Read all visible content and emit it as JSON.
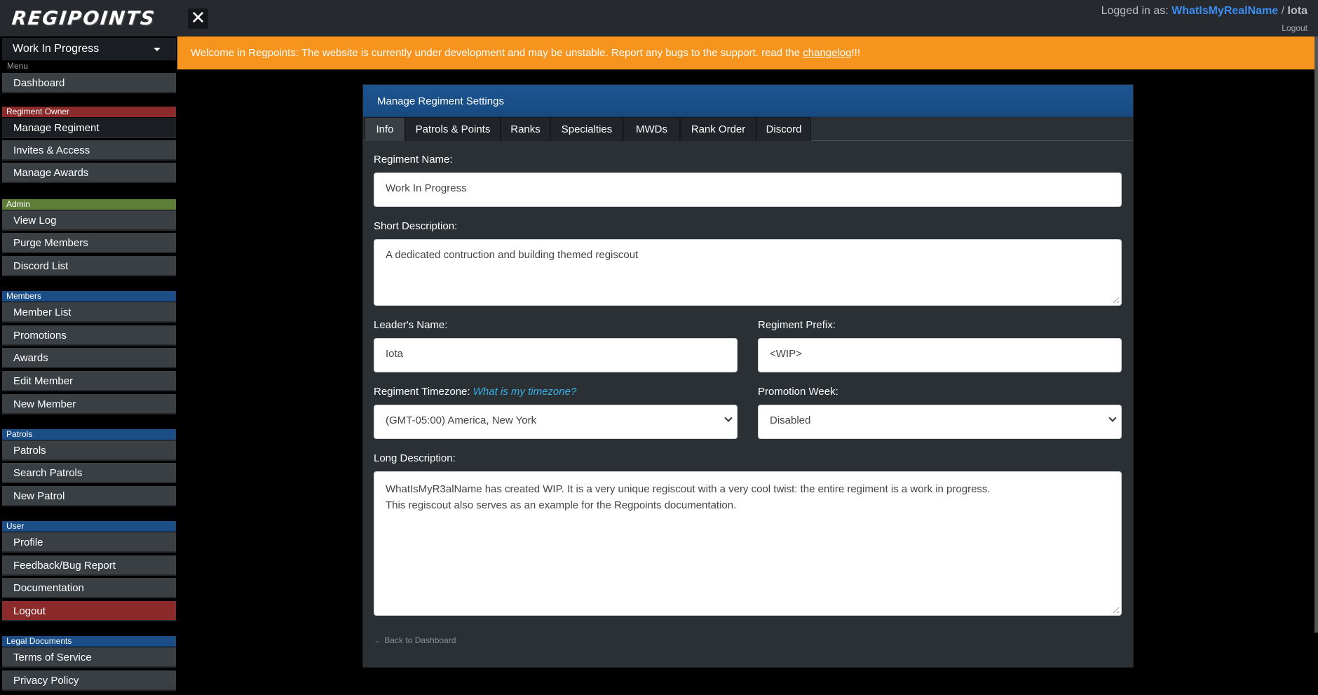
{
  "topbar": {
    "logo_text": "REGIPOINTS",
    "close_label": "✕",
    "logged_in_prefix": "Logged in as:",
    "username": "WhatIsMyRealName",
    "separator": "/",
    "alias": "Iota",
    "logout_label": "Logout"
  },
  "sidebar": {
    "regiment_selected": "Work In Progress",
    "menu_label": "Menu",
    "dashboard": "Dashboard",
    "sections": {
      "owner": {
        "title": "Regiment Owner",
        "items": [
          "Manage Regiment",
          "Invites & Access",
          "Manage Awards"
        ]
      },
      "admin": {
        "title": "Admin",
        "items": [
          "View Log",
          "Purge Members",
          "Discord List"
        ]
      },
      "members": {
        "title": "Members",
        "items": [
          "Member List",
          "Promotions",
          "Awards",
          "Edit Member",
          "New Member"
        ]
      },
      "patrols": {
        "title": "Patrols",
        "items": [
          "Patrols",
          "Search Patrols",
          "New Patrol"
        ]
      },
      "user": {
        "title": "User",
        "items": [
          "Profile",
          "Feedback/Bug Report",
          "Documentation",
          "Logout"
        ]
      },
      "legal": {
        "title": "Legal Documents",
        "items": [
          "Terms of Service",
          "Privacy Policy"
        ]
      }
    }
  },
  "alert": {
    "text": "Welcome in Regpoints: The website is currently under development and may be unstable. Report any bugs to the support. read the ",
    "link": "changelog",
    "suffix": "!!!"
  },
  "card": {
    "title": "Manage Regiment Settings",
    "tabs": [
      "Info",
      "Patrols & Points",
      "Ranks",
      "Specialties",
      "MWDs",
      "Rank Order",
      "Discord"
    ],
    "active_tab": "Info",
    "fields": {
      "regiment_name_label": "Regiment Name:",
      "regiment_name_value": "Work In Progress",
      "short_desc_label": "Short Description:",
      "short_desc_value": "A dedicated contruction and building themed regiscout",
      "leader_label": "Leader's Name:",
      "leader_value": "Iota",
      "prefix_label": "Regiment Prefix:",
      "prefix_value": "<WIP>",
      "timezone_label": "Regiment Timezone:",
      "timezone_link": "What is my timezone?",
      "timezone_value": "(GMT-05:00) America, New York",
      "promo_week_label": "Promotion Week:",
      "promo_week_value": "Disabled",
      "long_desc_label": "Long Description:",
      "long_desc_line1": "WhatIsMyR3alName has created WIP. It is a very unique regiscout with a very cool twist: the entire regiment is a work in progress.",
      "long_desc_line2": "This regiscout also serves as an example for the Regpoints documentation."
    },
    "back_link": "← Back to Dashboard"
  },
  "colors": {
    "accent_blue": "#1e5591",
    "alert_orange": "#f7941d",
    "danger_red": "#8b2a2a",
    "admin_green": "#5e7d37",
    "username_blue": "#3d8cf0"
  }
}
